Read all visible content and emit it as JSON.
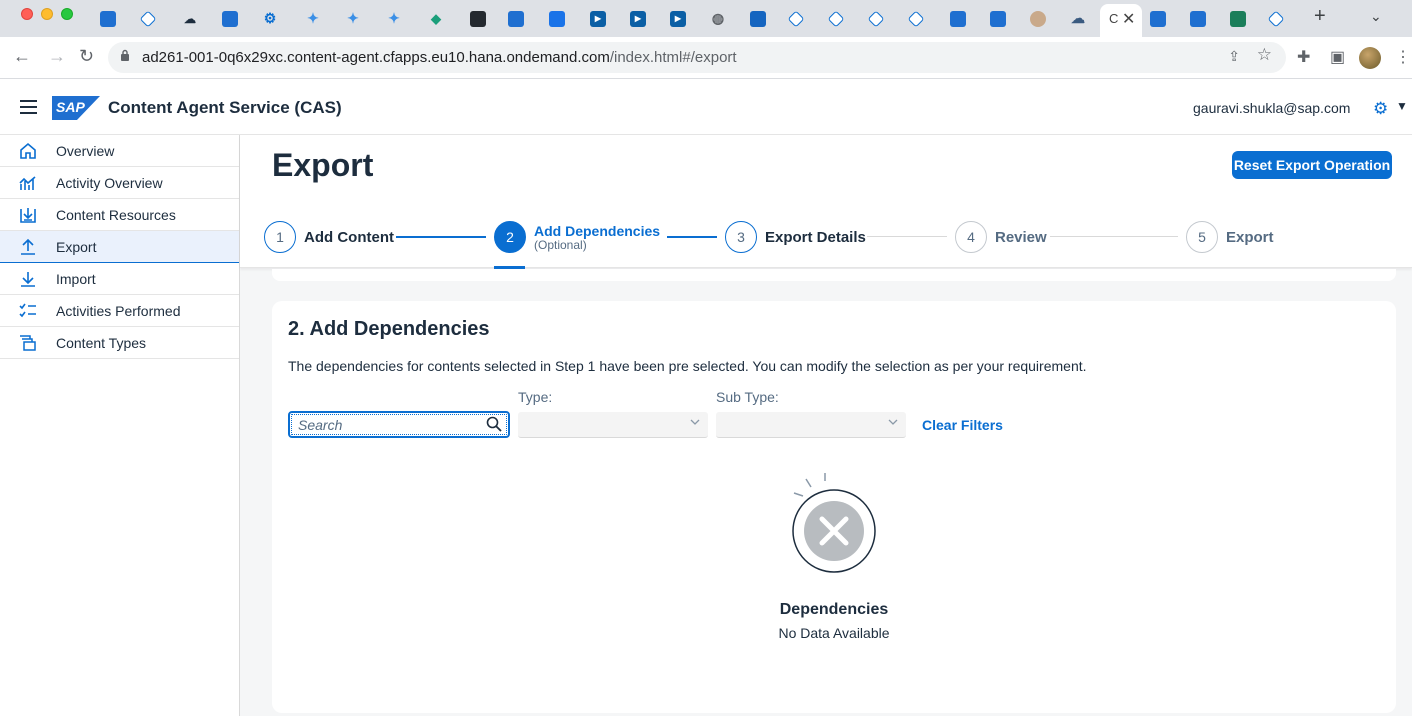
{
  "browser": {
    "url_host": "ad261-001-0q6x29xc.content-agent.cfapps.eu10.hana.ondemand.com",
    "url_path": "/index.html#/export",
    "active_tab_initial": "C"
  },
  "shell": {
    "logo_text": "SAP",
    "app_title": "Content Agent Service (CAS)",
    "user_email": "gauravi.shukla@sap.com"
  },
  "sidebar": {
    "items": [
      {
        "label": "Overview",
        "icon": "home-icon"
      },
      {
        "label": "Activity Overview",
        "icon": "line-chart-icon"
      },
      {
        "label": "Content Resources",
        "icon": "download-tray-icon"
      },
      {
        "label": "Export",
        "icon": "upload-icon",
        "selected": true
      },
      {
        "label": "Import",
        "icon": "download-icon"
      },
      {
        "label": "Activities Performed",
        "icon": "checklist-icon"
      },
      {
        "label": "Content Types",
        "icon": "stacked-pages-icon"
      }
    ]
  },
  "page": {
    "title": "Export",
    "reset_button": "Reset Export Operation"
  },
  "wizard": {
    "steps": [
      {
        "number": "1",
        "label": "Add Content"
      },
      {
        "number": "2",
        "label": "Add Dependencies",
        "sublabel": "(Optional)"
      },
      {
        "number": "3",
        "label": "Export Details"
      },
      {
        "number": "4",
        "label": "Review"
      },
      {
        "number": "5",
        "label": "Export"
      }
    ],
    "current_step": 2
  },
  "section": {
    "title": "2. Add Dependencies",
    "description": "The dependencies for contents selected in Step 1 have been pre selected. You can modify the selection as per your requirement.",
    "search_placeholder": "Search",
    "type_label": "Type:",
    "type_value": "",
    "subtype_label": "Sub Type:",
    "subtype_value": "",
    "clear_filters": "Clear Filters",
    "empty_title": "Dependencies",
    "empty_text": "No Data Available"
  },
  "colors": {
    "accent": "#0a6ed1",
    "text": "#1d2d3e",
    "background": "#f5f6f7"
  }
}
